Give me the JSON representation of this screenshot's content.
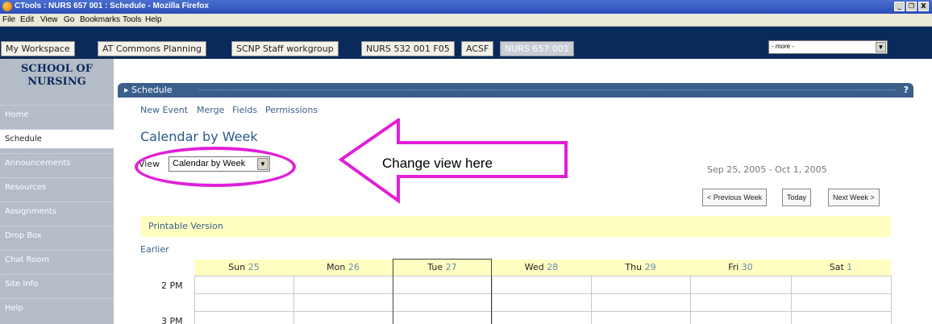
{
  "window": {
    "title": "CTools : NURS 657 001 : Schedule - Mozilla Firefox",
    "controls": [
      "_",
      "❐",
      "X"
    ]
  },
  "menu": [
    "File",
    "Edit",
    "View",
    "Go",
    "Bookmarks",
    "Tools",
    "Help"
  ],
  "site_tabs": [
    "My Workspace",
    "AT Commons Planning",
    "SCNP Staff workgroup",
    "NURS 532 001 F05",
    "ACSF",
    "NURS 657 001"
  ],
  "more_select": "- more -",
  "school": {
    "line1": "SCHOOL OF",
    "line2": "NURSING"
  },
  "nav": [
    "Home",
    "Schedule",
    "Announcements",
    "Resources",
    "Assignments",
    "Drop Box",
    "Chat Room",
    "Site Info",
    "Help"
  ],
  "portlet": {
    "title": "Schedule",
    "help": "?"
  },
  "actions": [
    "New Event",
    "Merge",
    "Fields",
    "Permissions"
  ],
  "page_title": "Calendar by Week",
  "view": {
    "label": "View",
    "selected": "Calendar by Week"
  },
  "annotation": "Change view here",
  "date_range": "Sep 25, 2005 - Oct 1, 2005",
  "buttons": {
    "prev": "< Previous Week",
    "today": "Today",
    "next": "Next Week >"
  },
  "printable": "Printable Version",
  "earlier": "Earlier",
  "days": [
    {
      "name": "Sun",
      "num": "25"
    },
    {
      "name": "Mon",
      "num": "26"
    },
    {
      "name": "Tue",
      "num": "27"
    },
    {
      "name": "Wed",
      "num": "28"
    },
    {
      "name": "Thu",
      "num": "29"
    },
    {
      "name": "Fri",
      "num": "30"
    },
    {
      "name": "Sat",
      "num": "1"
    }
  ],
  "times": [
    "2 PM",
    "3 PM"
  ],
  "colors": {
    "annotation": "#e01fd8",
    "site_bar": "#0a2a5c",
    "portlet_header": "#3b5f8c",
    "highlight": "#ffffc2"
  }
}
